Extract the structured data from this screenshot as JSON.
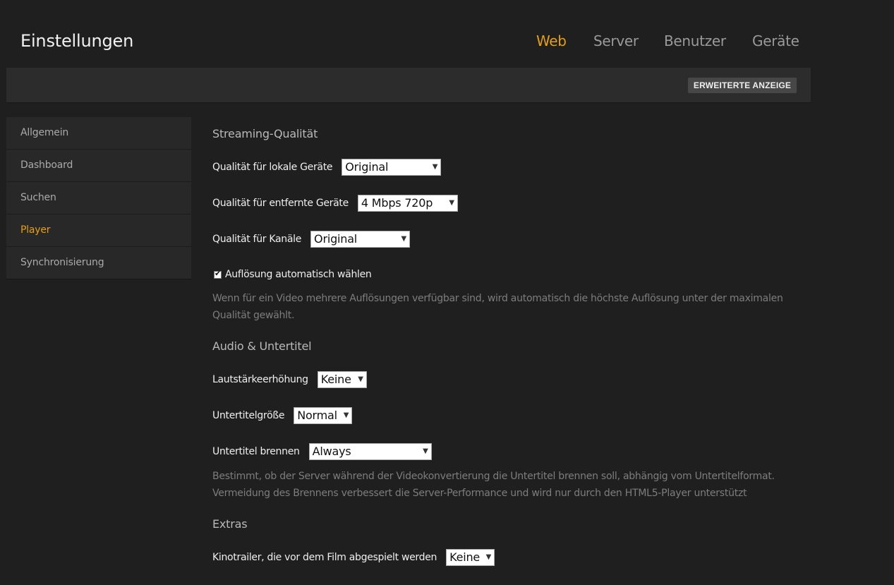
{
  "header": {
    "title": "Einstellungen",
    "tabs": [
      {
        "label": "Web",
        "active": true
      },
      {
        "label": "Server",
        "active": false
      },
      {
        "label": "Benutzer",
        "active": false
      },
      {
        "label": "Geräte",
        "active": false
      }
    ]
  },
  "toolbar": {
    "advanced_button_label": "ERWEITERTE ANZEIGE"
  },
  "sidebar": {
    "items": [
      {
        "label": "Allgemein",
        "active": false
      },
      {
        "label": "Dashboard",
        "active": false
      },
      {
        "label": "Suchen",
        "active": false
      },
      {
        "label": "Player",
        "active": true
      },
      {
        "label": "Synchronisierung",
        "active": false
      }
    ]
  },
  "streaming": {
    "heading": "Streaming-Qualität",
    "local_quality": {
      "label": "Qualität für lokale Geräte",
      "value": "Original"
    },
    "remote_quality": {
      "label": "Qualität für entfernte Geräte",
      "value": "4 Mbps 720p"
    },
    "channel_quality": {
      "label": "Qualität für Kanäle",
      "value": "Original"
    },
    "auto_resolution": {
      "label": "Auflösung automatisch wählen",
      "checked": true
    },
    "help": "Wenn für ein Video mehrere Auflösungen verfügbar sind, wird automatisch die höchste Auflösung unter der maximalen Qualität gewählt."
  },
  "audio": {
    "heading": "Audio & Untertitel",
    "volume_boost": {
      "label": "Lautstärkeerhöhung",
      "value": "Keine"
    },
    "subtitle_size": {
      "label": "Untertitelgröße",
      "value": "Normal"
    },
    "burn_subtitles": {
      "label": "Untertitel brennen",
      "value": "Always"
    },
    "help": "Bestimmt, ob der Server während der Videokonvertierung die Untertitel brennen soll, abhängig vom Untertitelformat. Vermeidung des Brennens verbessert die Server-Performance und wird nur durch den HTML5-Player unterstützt"
  },
  "extras": {
    "heading": "Extras",
    "trailers": {
      "label": "Kinotrailer, die vor dem Film abgespielt werden",
      "value": "Keine"
    }
  },
  "colors": {
    "accent": "#e5a00d",
    "background": "#1f1f1f",
    "panel": "#2c2c2c"
  },
  "icons": {
    "select_arrow": "chevron-down-icon",
    "checkbox": "check-icon"
  }
}
